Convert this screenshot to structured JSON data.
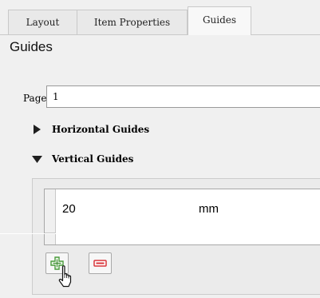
{
  "tabs": [
    {
      "label": "Layout"
    },
    {
      "label": "Item Properties"
    },
    {
      "label": "Guides"
    }
  ],
  "section_title": "Guides",
  "page": {
    "label": "Page",
    "value": "1"
  },
  "groups": {
    "horizontal": "Horizontal Guides",
    "vertical": "Vertical Guides"
  },
  "vertical_guides": {
    "rows": [
      {
        "position": "20",
        "unit": "mm"
      }
    ]
  },
  "buttons": {
    "add_icon": "plus-icon",
    "remove_icon": "minus-icon"
  },
  "colors": {
    "add_green": "#4a9b3c",
    "remove_red": "#d8363c"
  }
}
